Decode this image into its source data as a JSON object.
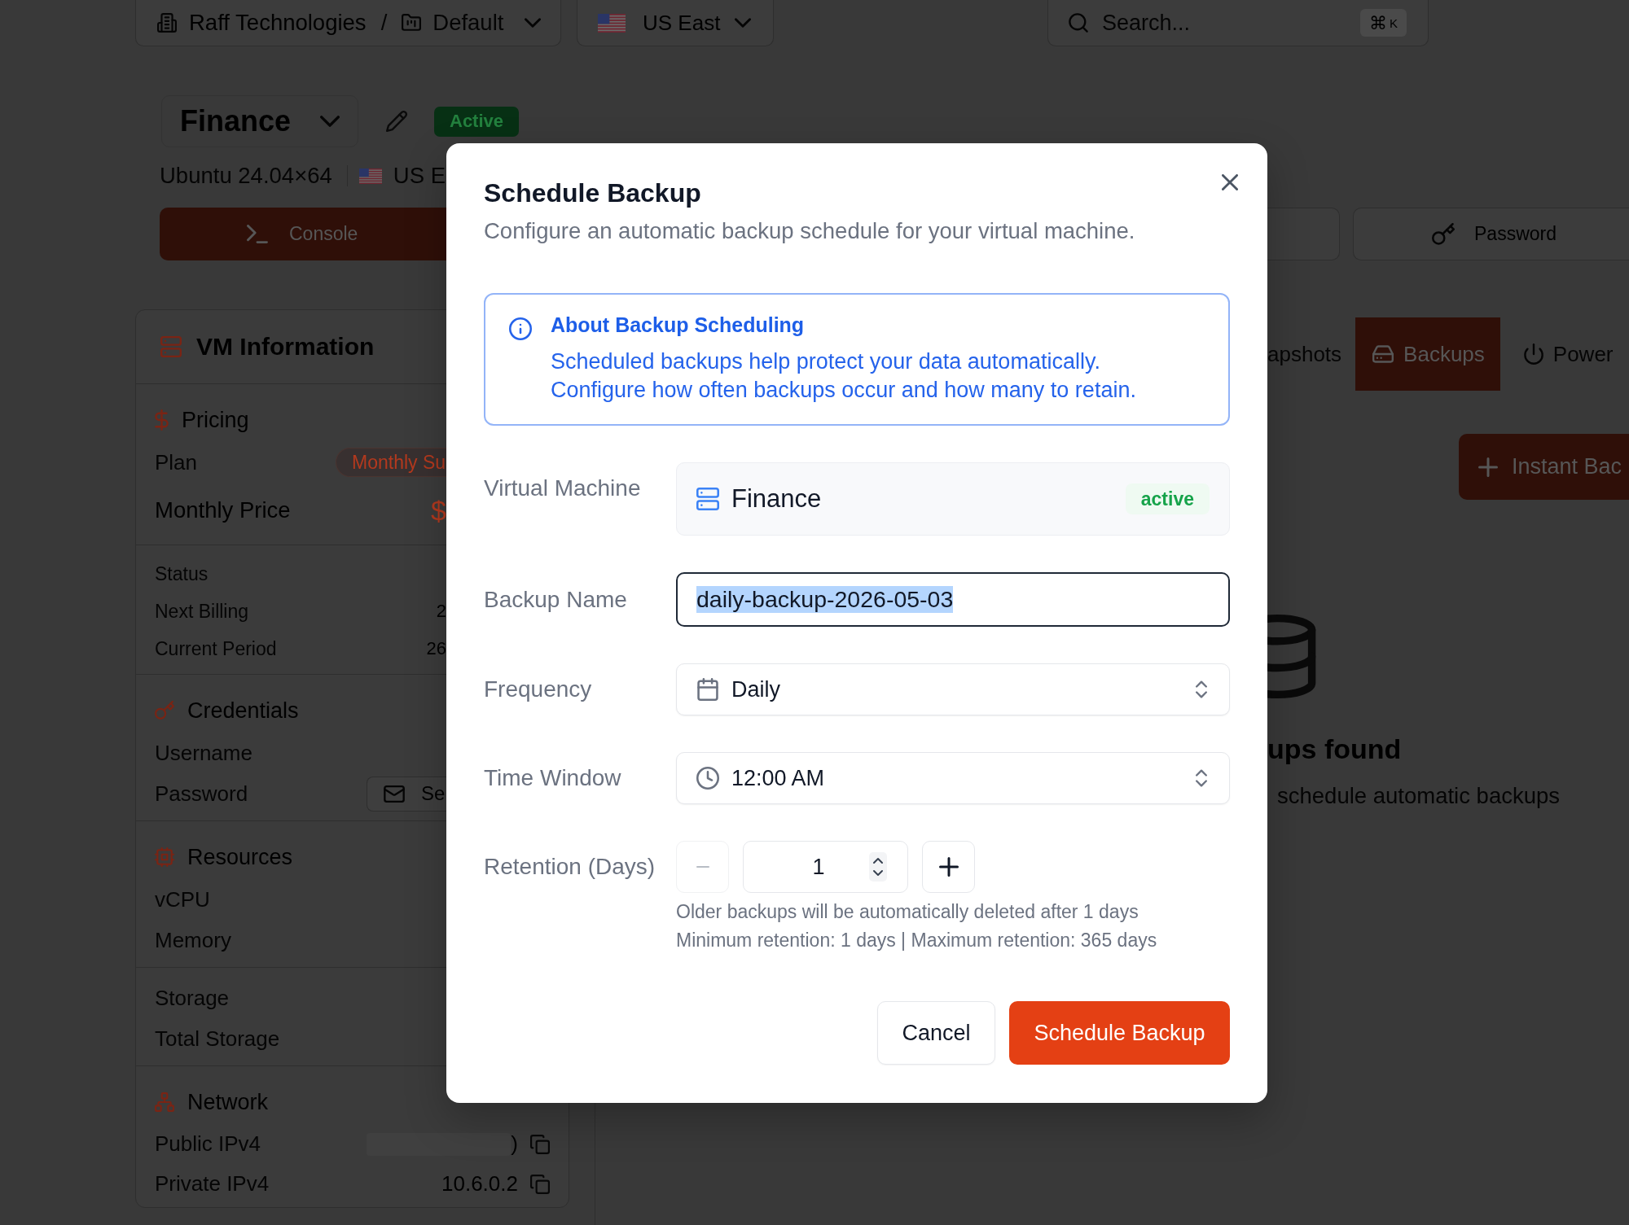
{
  "topbar": {
    "organization": "Raff Technologies",
    "separator": "/",
    "project": "Default",
    "region": "US East",
    "search": {
      "placeholder": "Search...",
      "shortcut_symbol": "⌘",
      "shortcut_key": "K"
    }
  },
  "vm_header": {
    "name": "Finance",
    "status": "Active",
    "os": "Ubuntu 24.04×64",
    "region": "US E",
    "console_button": "Console",
    "password_button": "Password"
  },
  "vm_info": {
    "title": "VM Information",
    "sections": [
      {
        "kind": "pricing",
        "title": "Pricing",
        "groups": [
          [
            {
              "label": "Plan",
              "kind": "badge",
              "value": "Monthly Su"
            },
            {
              "label": "Monthly Price",
              "kind": "price",
              "value": "$"
            }
          ],
          [
            {
              "label": "Status",
              "kind": "detail"
            },
            {
              "label": "Next Billing",
              "kind": "detail",
              "value": "2"
            },
            {
              "label": "Current Period",
              "kind": "detail",
              "value": "26"
            }
          ]
        ]
      },
      {
        "kind": "credentials",
        "title": "Credentials",
        "groups": [
          [
            {
              "label": "Username",
              "kind": "plain"
            },
            {
              "label": "Password",
              "kind": "button",
              "value": "Se"
            }
          ]
        ]
      },
      {
        "kind": "resources",
        "title": "Resources",
        "groups": [
          [
            {
              "label": "vCPU",
              "kind": "plain"
            },
            {
              "label": "Memory",
              "kind": "plain"
            }
          ],
          [
            {
              "label": "Storage",
              "kind": "plain"
            },
            {
              "label": "Total Storage",
              "kind": "plain"
            }
          ]
        ]
      },
      {
        "kind": "network",
        "title": "Network",
        "groups": [
          [
            {
              "label": "Public IPv4",
              "kind": "masked",
              "value": ")"
            },
            {
              "label": "Private IPv4",
              "kind": "copy",
              "value": "10.6.0.2"
            }
          ]
        ]
      }
    ]
  },
  "backups_panel": {
    "tabs": [
      {
        "kind": "snapshots",
        "label": "apshots",
        "selected": false
      },
      {
        "kind": "backups",
        "label": "Backups",
        "selected": true
      },
      {
        "kind": "power",
        "label": "Power",
        "selected": false
      }
    ],
    "instant_button": "Instant Bac",
    "empty_state": {
      "title": "ups found",
      "text": "schedule automatic backups"
    }
  },
  "dialog": {
    "title": "Schedule Backup",
    "subtitle": "Configure an automatic backup schedule for your virtual machine.",
    "info": {
      "title": "About Backup Scheduling",
      "lines": [
        "Scheduled backups help protect your data automatically.",
        "Configure how often backups occur and how many to retain."
      ]
    },
    "fields": [
      {
        "kind": "vm",
        "label": "Virtual Machine",
        "value": "Finance",
        "status": "active"
      },
      {
        "kind": "text",
        "label": "Backup Name",
        "value": "daily-backup-2026-05-03",
        "focused": true
      },
      {
        "kind": "frequency",
        "label": "Frequency",
        "value": "Daily"
      },
      {
        "kind": "time",
        "label": "Time Window",
        "value": "12:00 AM"
      },
      {
        "kind": "stepper",
        "label": "Retention (Days)",
        "value": "1",
        "decrease_disabled": true,
        "hints": [
          "Older backups will be automatically deleted after 1 days",
          "Minimum retention: 1 days | Maximum retention: 365 days"
        ]
      }
    ],
    "buttons": [
      {
        "kind": "secondary",
        "label": "Cancel"
      },
      {
        "kind": "primary",
        "label": "Schedule Backup"
      }
    ]
  }
}
